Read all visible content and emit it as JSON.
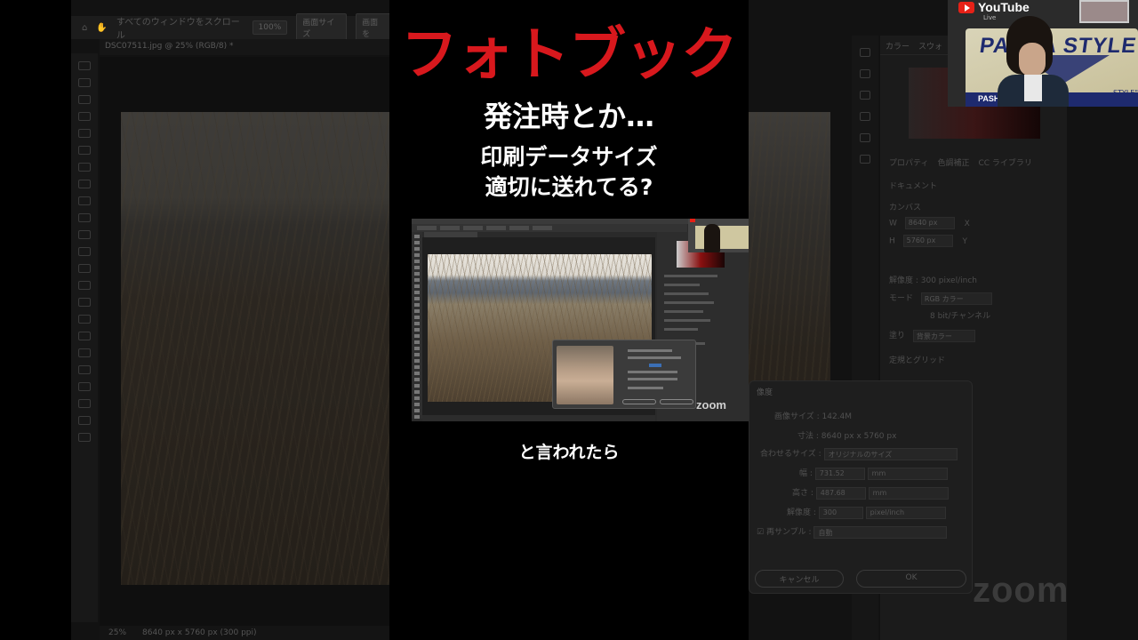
{
  "short": {
    "title": "フォトブック",
    "subtitle": "発注時とか…",
    "question_line1": "印刷データサイズ",
    "question_line2": "適切に送れてる?",
    "caption": "と言われたら"
  },
  "background_ps": {
    "options_bar": {
      "scroll_all_windows": "すべてのウィンドウをスクロール",
      "zoom_100": "100%",
      "fit_screen": "画面サイズ",
      "fill_screen": "画面を"
    },
    "document_tab": "DSC07511.jpg @ 25% (RGB/8) *",
    "status_bar": {
      "zoom": "25%",
      "doc_size": "8640 px x 5760 px (300 ppi)"
    },
    "panel": {
      "tabs": [
        "カラー",
        "スウォ"
      ],
      "properties_tabs": [
        "プロパティ",
        "色調補正",
        "CC ライブラリ"
      ],
      "document_label": "ドキュメント",
      "canvas_section": "カンバス",
      "width_label": "W",
      "width_value": "8640 px",
      "height_label": "H",
      "height_value": "5760 px",
      "x_label": "X",
      "y_label": "Y",
      "resolution": "解像度 : 300 pixel/inch",
      "mode_label": "モード",
      "mode_value": "RGB カラー",
      "bit_depth": "8 bit/チャンネル",
      "fill_label": "塗り",
      "fill_value": "背景カラー",
      "rulers_section": "定規とグリッド"
    },
    "dialog": {
      "title": "像度",
      "image_size_label": "画像サイズ :",
      "image_size_value": "142.4M",
      "dimensions_label": "寸法 :",
      "dimensions_value": "8640 px x 5760 px",
      "fit_label": "合わせるサイズ :",
      "fit_value": "オリジナルのサイズ",
      "width_label": "幅 :",
      "width_value": "731.52",
      "width_unit": "mm",
      "height_label": "高さ :",
      "height_value": "487.68",
      "height_unit": "mm",
      "resolution_label": "解像度 :",
      "resolution_value": "300",
      "resolution_unit": "pixel/inch",
      "resample_label": "再サンプル :",
      "resample_value": "自動",
      "cancel_button": "キャンセル",
      "ok_button": "OK"
    },
    "zoom_watermark": "zoom"
  },
  "webcam": {
    "youtube_label": "YouTube",
    "youtube_sub": "Live",
    "logo_text": "PASHA STYLE",
    "logo_bar_text": "PASHA STYLE",
    "logo_tm": "STYLE\""
  },
  "mini_screenshot": {
    "zoom_watermark": "zoom"
  },
  "colors": {
    "title_red": "#d8181d",
    "text_white": "#ffffff",
    "background": "#000000"
  }
}
